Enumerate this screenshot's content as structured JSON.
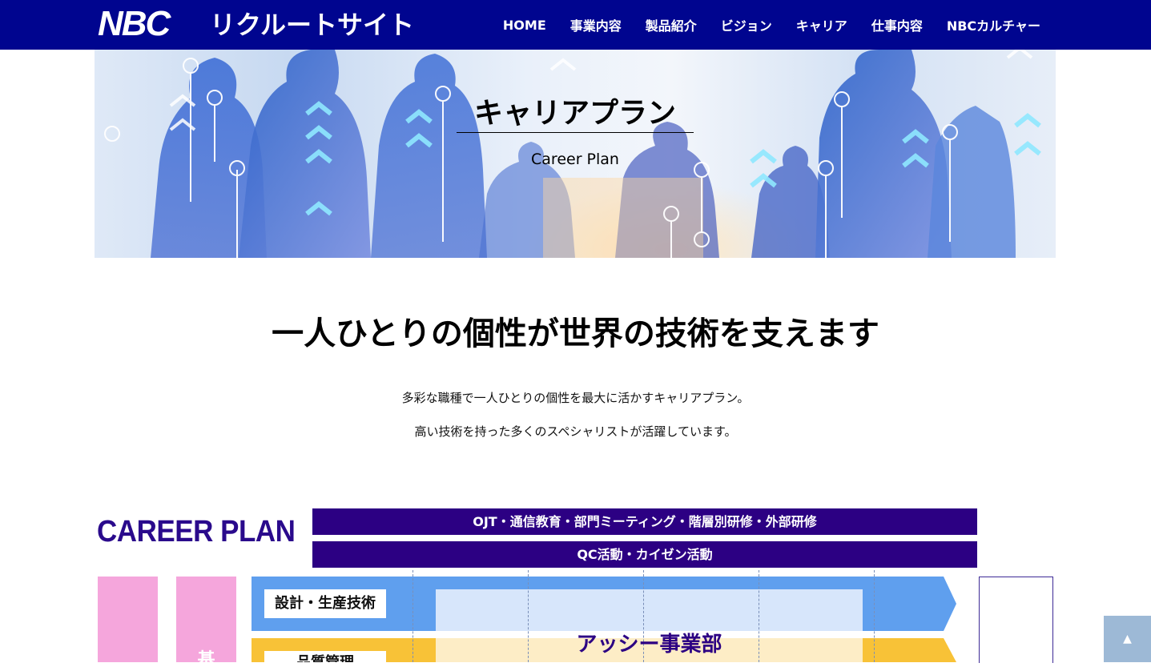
{
  "header": {
    "logo": "NBC",
    "site_title": "リクルートサイト",
    "nav": [
      {
        "label": "HOME"
      },
      {
        "label": "事業内容"
      },
      {
        "label": "製品紹介"
      },
      {
        "label": "ビジョン"
      },
      {
        "label": "キャリア"
      },
      {
        "label": "仕事内容"
      },
      {
        "label": "NBCカルチャー"
      }
    ]
  },
  "hero": {
    "title": "キャリアプラン",
    "subtitle": "Career Plan"
  },
  "intro": {
    "headline": "一人ひとりの個性が世界の技術を支えます",
    "line1": "多彩な職種で一人ひとりの個性を最大に活かすキャリアプラン。",
    "line2": "高い技術を持った多くのスペシャリストが活躍しています。"
  },
  "career_plan": {
    "title": "CAREER PLAN",
    "bar1": "OJT・通信教育・部門ミーティング・階層別研修・外部研修",
    "bar2": "QC活動・カイゼン活動",
    "column2_char": "基",
    "track1_label": "設計・生産技術",
    "track2_label": "品質管理",
    "department": "アッシー事業部"
  },
  "colors": {
    "header_bg": "#00058f",
    "bar_bg": "#2c0083",
    "pink": "#f5a6dc",
    "blue_track": "#5f9fee",
    "orange_track": "#f8c237"
  },
  "totop_icon": "arrow-up-icon"
}
